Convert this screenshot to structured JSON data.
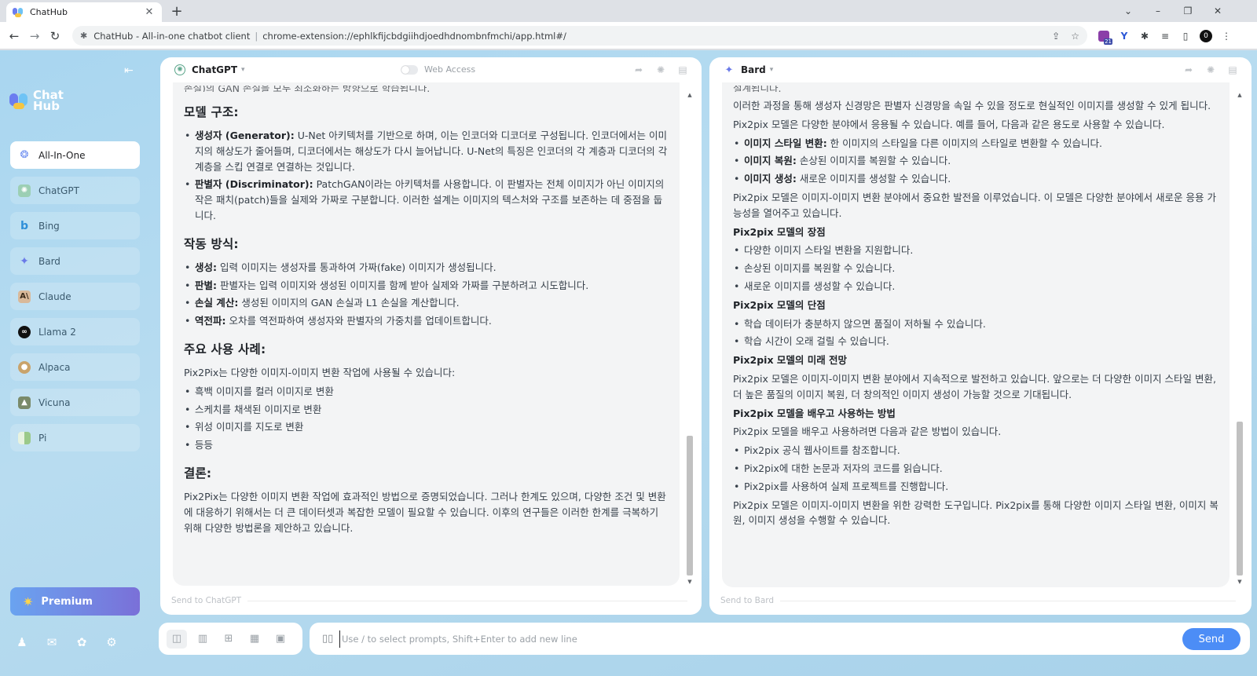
{
  "browser": {
    "tab_title": "ChatHub",
    "tab_close": "✕",
    "new_tab": "+",
    "site_name": "ChatHub - All-in-one chatbot client",
    "separator": "|",
    "url": "chrome-extension://ephlkfijcbdgiihdjoedhdnombnfmchi/app.html#/",
    "ext_badge": "21"
  },
  "sidebar": {
    "collapse_glyph": "⇤",
    "logo_line1": "Chat",
    "logo_line2": "Hub",
    "items": [
      {
        "label": "All-In-One",
        "active": true
      },
      {
        "label": "ChatGPT"
      },
      {
        "label": "Bing"
      },
      {
        "label": "Bard"
      },
      {
        "label": "Claude"
      },
      {
        "label": "Llama 2"
      },
      {
        "label": "Alpaca"
      },
      {
        "label": "Vicuna"
      },
      {
        "label": "Pi"
      }
    ],
    "premium_label": "Premium"
  },
  "left_panel": {
    "bot_name": "ChatGPT",
    "web_access_label": "Web Access",
    "send_to": "Send to ChatGPT",
    "cut_top": "손실)의 GAN 손실을 모두 최소화하는 방향으로 학습됩니다.",
    "h_model": "모델 구조:",
    "gen_term": "생성자 (Generator):",
    "gen_text": " U-Net 아키텍처를 기반으로 하며, 이는 인코더와 디코더로 구성됩니다. 인코더에서는 이미지의 해상도가 줄어들며, 디코더에서는 해상도가 다시 늘어납니다. U-Net의 특징은 인코더의 각 계층과 디코더의 각 계층을 스킵 연결로 연결하는 것입니다.",
    "disc_term": "판별자 (Discriminator):",
    "disc_text": " PatchGAN이라는 아키텍처를 사용합니다. 이 판별자는 전체 이미지가 아닌 이미지의 작은 패치(patch)들을 실제와 가짜로 구분합니다. 이러한 설계는 이미지의 텍스처와 구조를 보존하는 데 중점을 둡니다.",
    "h_operation": "작동 방식:",
    "op1_term": "생성:",
    "op1_text": " 입력 이미지는 생성자를 통과하여 가짜(fake) 이미지가 생성됩니다.",
    "op2_term": "판별:",
    "op2_text": " 판별자는 입력 이미지와 생성된 이미지를 함께 받아 실제와 가짜를 구분하려고 시도합니다.",
    "op3_term": "손실 계산:",
    "op3_text": " 생성된 이미지의 GAN 손실과 L1 손실을 계산합니다.",
    "op4_term": "역전파:",
    "op4_text": " 오차를 역전파하여 생성자와 판별자의 가중치를 업데이트합니다.",
    "h_usecases": "주요 사용 사례:",
    "usecases_intro": "Pix2Pix는 다양한 이미지-이미지 변환 작업에 사용될 수 있습니다:",
    "usecases": [
      "흑백 이미지를 컬러 이미지로 변환",
      "스케치를 채색된 이미지로 변환",
      "위성 이미지를 지도로 변환",
      "등등"
    ],
    "h_conclusion": "결론:",
    "conclusion": "Pix2Pix는 다양한 이미지 변환 작업에 효과적인 방법으로 증명되었습니다. 그러나 한계도 있으며, 다양한 조건 및 변환에 대응하기 위해서는 더 큰 데이터셋과 복잡한 모델이 필요할 수 있습니다. 이후의 연구들은 이러한 한계를 극복하기 위해 다양한 방법론을 제안하고 있습니다."
  },
  "right_panel": {
    "bot_name": "Bard",
    "send_to": "Send to Bard",
    "cut_top": "설계됩니다.",
    "p1": "이러한 과정을 통해 생성자 신경망은 판별자 신경망을 속일 수 있을 정도로 현실적인 이미지를 생성할 수 있게 됩니다.",
    "p2": "Pix2pix 모델은 다양한 분야에서 응용될 수 있습니다. 예를 들어, 다음과 같은 용도로 사용할 수 있습니다.",
    "app1_term": "이미지 스타일 변환:",
    "app1_text": " 한 이미지의 스타일을 다른 이미지의 스타일로 변환할 수 있습니다.",
    "app2_term": "이미지 복원:",
    "app2_text": " 손상된 이미지를 복원할 수 있습니다.",
    "app3_term": "이미지 생성:",
    "app3_text": " 새로운 이미지를 생성할 수 있습니다.",
    "p3": "Pix2pix 모델은 이미지-이미지 변환 분야에서 중요한 발전을 이루었습니다. 이 모델은 다양한 분야에서 새로운 응용 가능성을 열어주고 있습니다.",
    "h_pros": "Pix2pix 모델의 장점",
    "pros": [
      "다양한 이미지 스타일 변환을 지원합니다.",
      "손상된 이미지를 복원할 수 있습니다.",
      "새로운 이미지를 생성할 수 있습니다."
    ],
    "h_cons": "Pix2pix 모델의 단점",
    "cons": [
      "학습 데이터가 충분하지 않으면 품질이 저하될 수 있습니다.",
      "학습 시간이 오래 걸릴 수 있습니다."
    ],
    "h_future": "Pix2pix 모델의 미래 전망",
    "future": "Pix2pix 모델은 이미지-이미지 변환 분야에서 지속적으로 발전하고 있습니다. 앞으로는 더 다양한 이미지 스타일 변환, 더 높은 품질의 이미지 복원, 더 창의적인 이미지 생성이 가능할 것으로 기대됩니다.",
    "h_howto": "Pix2pix 모델을 배우고 사용하는 방법",
    "howto_intro": "Pix2pix 모델을 배우고 사용하려면 다음과 같은 방법이 있습니다.",
    "howto": [
      "Pix2pix 공식 웹사이트를 참조합니다.",
      "Pix2pix에 대한 논문과 저자의 코드를 읽습니다.",
      "Pix2pix를 사용하여 실제 프로젝트를 진행합니다."
    ],
    "closing": "Pix2pix 모델은 이미지-이미지 변환을 위한 강력한 도구입니다. Pix2pix를 통해 다양한 이미지 스타일 변환, 이미지 복원, 이미지 생성을 수행할 수 있습니다."
  },
  "input": {
    "placeholder": "Use / to select prompts, Shift+Enter to add new line",
    "send_label": "Send"
  },
  "colors": {
    "accent": "#4c8df6",
    "premium_start": "#6aa3f0",
    "premium_end": "#7a70d8"
  }
}
